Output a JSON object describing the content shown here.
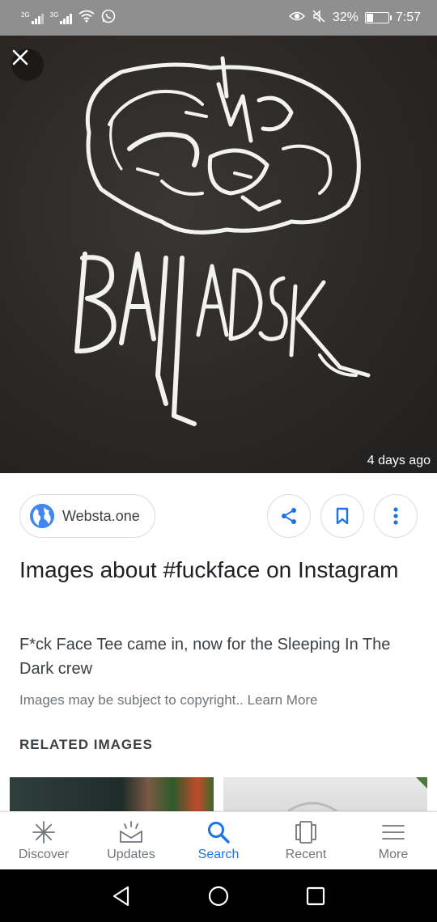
{
  "status_bar": {
    "sim1": "2G",
    "sim2": "3G",
    "battery": "32%",
    "battery_level": 0.32,
    "time": "7:57"
  },
  "image_viewer": {
    "close_icon": "close-icon",
    "age": "4 days ago"
  },
  "source": {
    "name": "Websta.one",
    "icon": "globe-icon"
  },
  "actions": {
    "share_icon": "share-icon",
    "bookmark_icon": "bookmark-icon",
    "more_icon": "more-vert-icon"
  },
  "result": {
    "title": "Images about #fuckface on Instagram",
    "description": "F*ck Face Tee came in, now for the Sleeping In The Dark crew",
    "copyright": "Images may be subject to copyright.. Learn More"
  },
  "related": {
    "heading": "RELATED IMAGES"
  },
  "bottom_nav": {
    "items": [
      {
        "label": "Discover",
        "icon": "asterisk-icon",
        "active": false
      },
      {
        "label": "Updates",
        "icon": "updates-icon",
        "active": false
      },
      {
        "label": "Search",
        "icon": "search-icon",
        "active": true
      },
      {
        "label": "Recent",
        "icon": "recent-icon",
        "active": false
      },
      {
        "label": "More",
        "icon": "menu-icon",
        "active": false
      }
    ]
  },
  "colors": {
    "accent": "#1a73e8",
    "status_bar": "#8f8f8f",
    "globe": "#4285f4"
  }
}
